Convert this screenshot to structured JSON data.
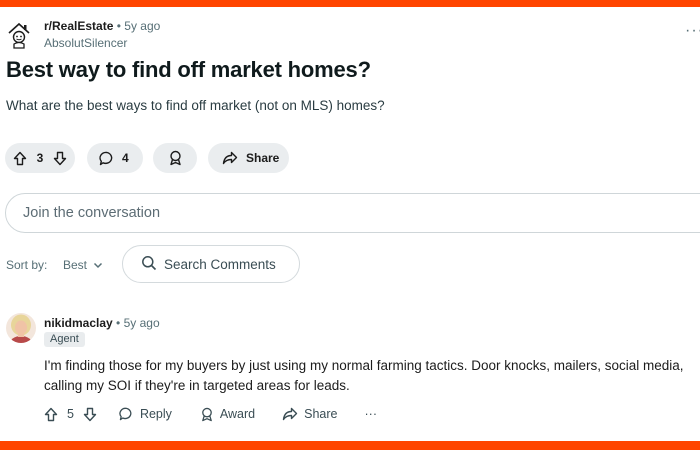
{
  "post": {
    "subreddit": "r/RealEstate",
    "time": "5y ago",
    "author": "AbsolutSilencer",
    "title": "Best way to find off market homes?",
    "body": "What are the best ways to find off market (not on MLS) homes?",
    "votes": "3",
    "comments": "4",
    "share_label": "Share"
  },
  "composer": {
    "placeholder": "Join the conversation"
  },
  "sort": {
    "label": "Sort by:",
    "value": "Best"
  },
  "search": {
    "label": "Search Comments"
  },
  "comment": {
    "author": "nikidmaclay",
    "time": "5y ago",
    "flair": "Agent",
    "text": "I'm finding those for my buyers by just using my normal farming tactics. Door knocks, mailers, social media, calling my SOI if they're in targeted areas for leads.",
    "votes": "5",
    "reply_label": "Reply",
    "award_label": "Award",
    "share_label": "Share",
    "more_label": "···"
  },
  "colors": {
    "brand": "#ff4500",
    "pill": "#eaedef",
    "muted": "#576f76"
  }
}
